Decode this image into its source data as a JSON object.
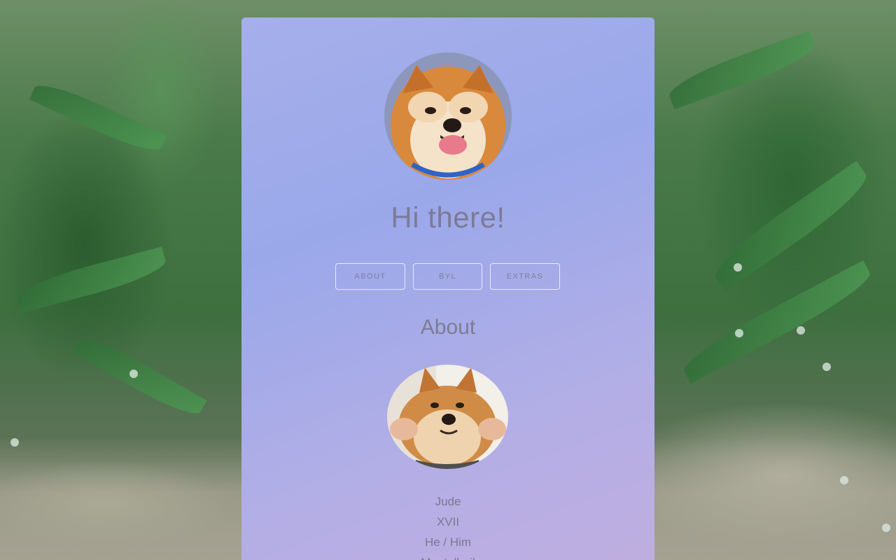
{
  "profile": {
    "greeting": "Hi there!",
    "avatar_label": "shiba-inu-avatar"
  },
  "nav": {
    "about": "ABOUT",
    "byl": "BYL",
    "extras": "EXTRAS"
  },
  "about": {
    "title": "About",
    "photo_label": "shiba-inu-photo",
    "lines": [
      "Jude",
      "XVII",
      "He / Him",
      "Montelbuil"
    ]
  },
  "colors": {
    "card_gradient_start": "#a6afea",
    "card_gradient_end": "#c0aedf",
    "text": "#7c7b96"
  }
}
